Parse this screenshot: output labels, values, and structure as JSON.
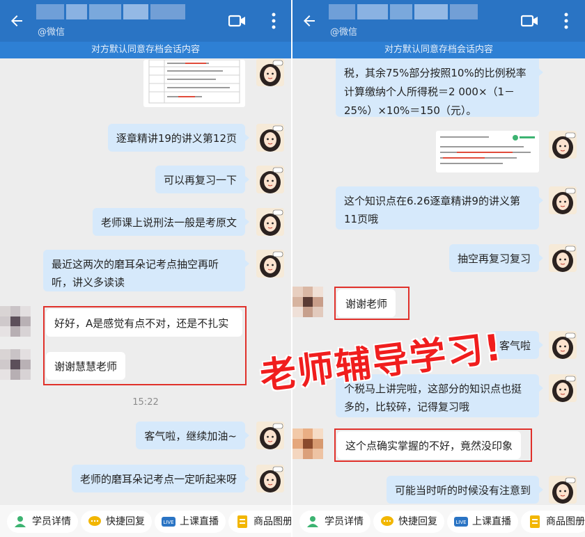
{
  "left": {
    "wx_tag": "@微信",
    "notice": "对方默认同意存档会话内容",
    "messages": [
      "逐章精讲19的讲义第12页",
      "可以再复习一下",
      "老师课上说刑法一般是考原文",
      "最近这两次的磨耳朵记考点抽空再听听，讲义多读读",
      "好好，A是感觉有点不对，还是不扎实",
      "谢谢慧慧老师",
      "客气啦，继续加油~",
      "老师的磨耳朵记考点一定听起来呀"
    ],
    "time": "15:22"
  },
  "right": {
    "wx_tag": "@微信",
    "notice": "对方默认同意存档会话内容",
    "messages": [
      "税，其余75%部分按照10%的比例税率计算缴纳个人所得税＝2 000×（1－25%）×10%＝150（元）。",
      "这个知识点在6.26逐章精讲9的讲义第11页哦",
      "抽空再复习复习",
      "谢谢老师",
      "客气啦",
      "个税马上讲完啦，这部分的知识点也挺多的，比较碎，记得复习哦",
      "这个点确实掌握的不好，竟然没印象",
      "可能当时听的时候没有注意到"
    ]
  },
  "bottom_bar": [
    "学员详情",
    "快捷回复",
    "上课直播",
    "商品图册"
  ],
  "overlay": "老师辅导学习!",
  "colors": {
    "header": "#2a74c4",
    "notice_bar": "#2e80d4",
    "bubble": "#d6e9fb",
    "highlight": "#e0302a"
  }
}
